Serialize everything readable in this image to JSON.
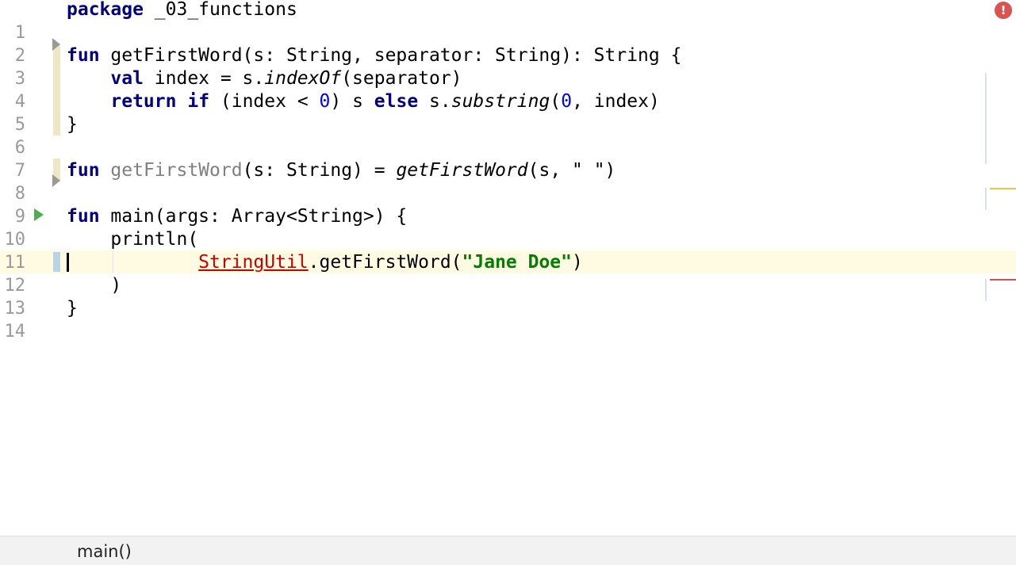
{
  "editor": {
    "line_numbers": [
      "1",
      "2",
      "3",
      "4",
      "5",
      "6",
      "7",
      "8",
      "9",
      "10",
      "11",
      "12",
      "13",
      "14"
    ],
    "line1": {
      "kw_package": "package",
      "pkg": " _03_functions"
    },
    "line3": {
      "kw_fun": "fun",
      "rest": " getFirstWord(s: String, separator: String): String {"
    },
    "line4": {
      "indent": "    ",
      "kw_val": "val",
      "mid": " index = s.",
      "call": "indexOf",
      "tail": "(separator)"
    },
    "line5": {
      "indent": "    ",
      "kw_return": "return",
      "sp1": " ",
      "kw_if": "if",
      "cond1": " (index < ",
      "zero1": "0",
      "cond2": ") s ",
      "kw_else": "else",
      "mid": " s.",
      "call": "substring",
      "open": "(",
      "zero2": "0",
      "tail": ", index)"
    },
    "line6": {
      "text": "}"
    },
    "line8": {
      "kw_fun": "fun",
      "sp": " ",
      "name": "getFirstWord",
      "params": "(s: String) = ",
      "call": "getFirstWord",
      "tail": "(s, \" \")"
    },
    "line10": {
      "kw_fun": "fun",
      "rest": " main(args: Array<String>) {"
    },
    "line11": {
      "text": "    println("
    },
    "line12": {
      "indent": "            ",
      "unresolved": "StringUtil",
      "mid": ".getFirstWord(",
      "str": "\"Jane Doe\"",
      "tail": ")"
    },
    "line13": {
      "text": "    )"
    },
    "line14": {
      "text": "}"
    }
  },
  "status_bar": {
    "breadcrumb": "main()"
  },
  "colors": {
    "keyword": "#000080",
    "number": "#0000ff",
    "string": "#008000",
    "error": "#cc0000",
    "current_line": "#fffbe3",
    "gutter_change": "#efe6c2"
  },
  "icons": {
    "error_indicator": "error-icon",
    "run_gutter": "run-icon",
    "fold_markers": "fold-marker-icon"
  }
}
